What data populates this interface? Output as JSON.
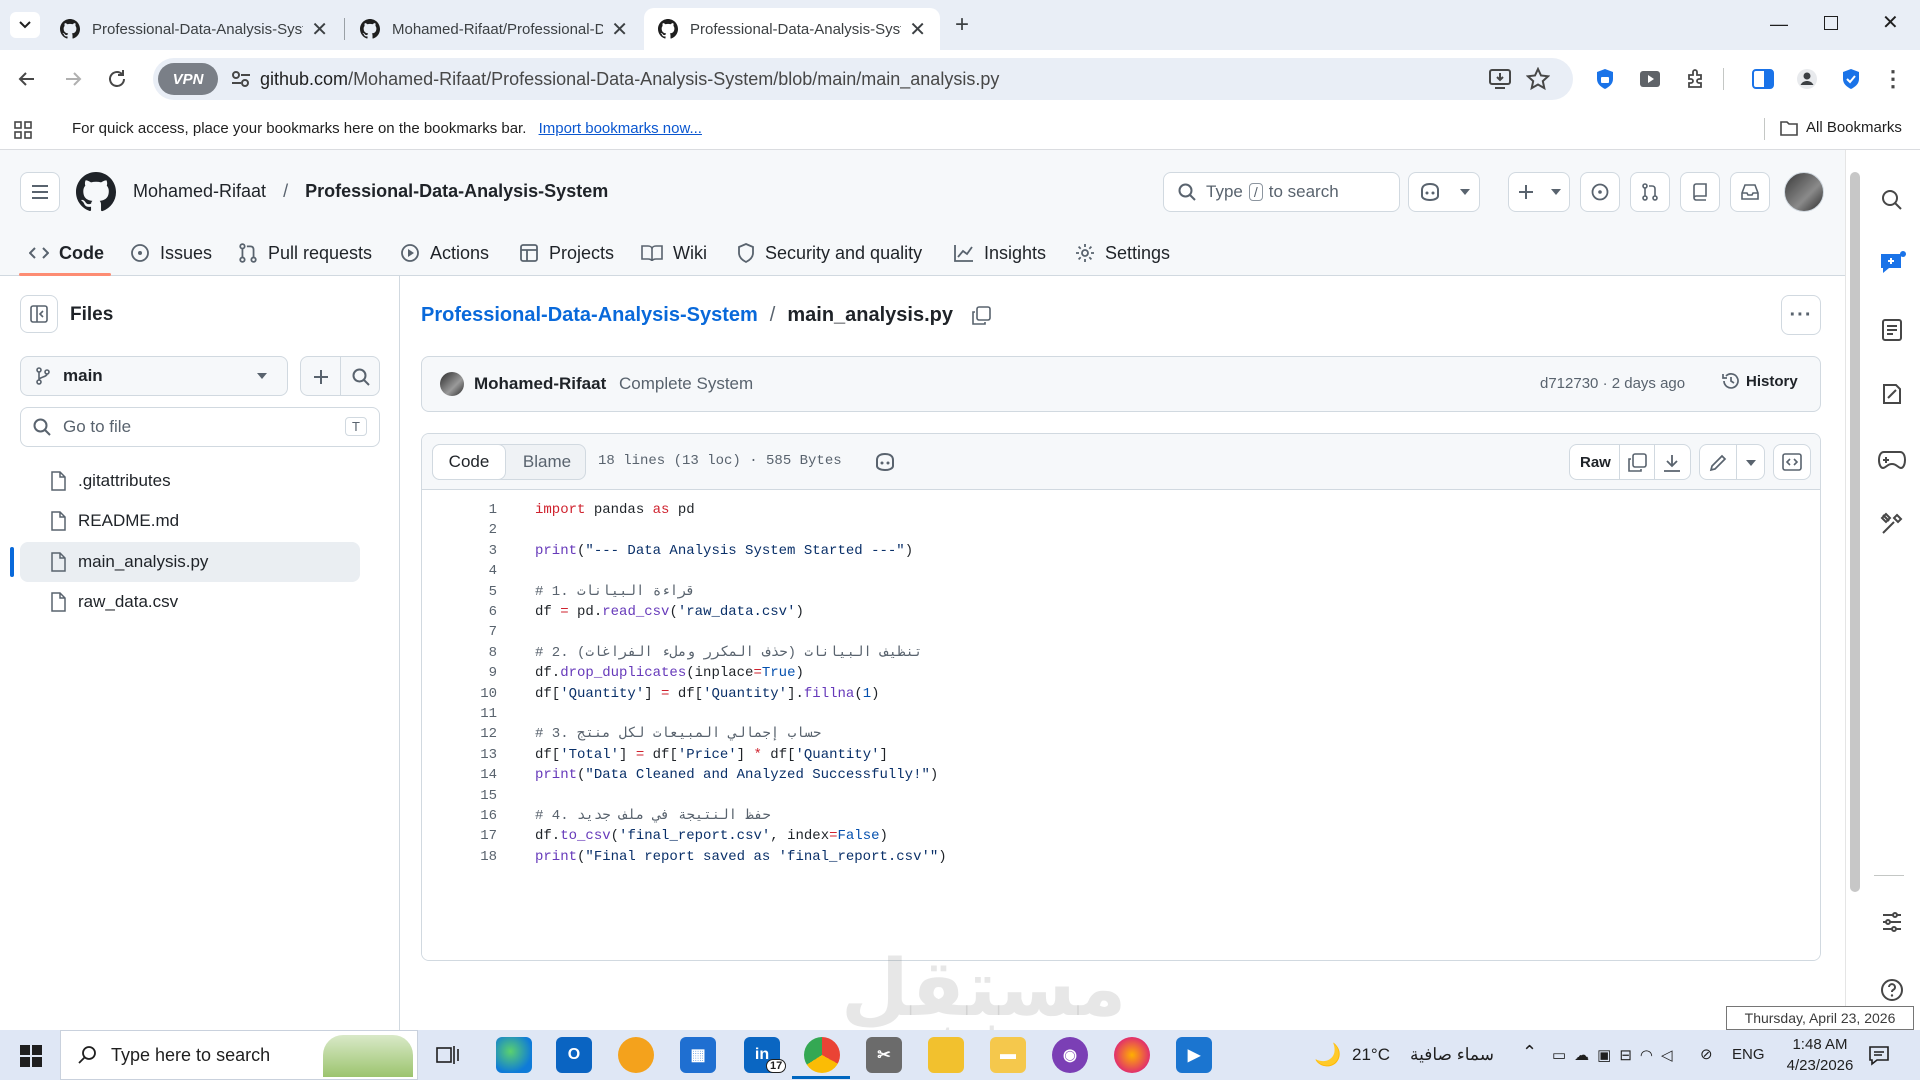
{
  "browser": {
    "tabs": [
      {
        "label": "Professional-Data-Analysis-Syst",
        "active": false
      },
      {
        "label": "Mohamed-Rifaat/Professional-D",
        "active": false
      },
      {
        "label": "Professional-Data-Analysis-Syst",
        "active": true
      }
    ],
    "url_host": "github.com",
    "url_path": "/Mohamed-Rifaat/Professional-Data-Analysis-System/blob/main/main_analysis.py",
    "vpn_label": "VPN",
    "bookmarks_text": "For quick access, place your bookmarks here on the bookmarks bar.",
    "bookmarks_link": "Import bookmarks now...",
    "all_bookmarks": "All Bookmarks"
  },
  "github": {
    "owner": "Mohamed-Rifaat",
    "separator": "/",
    "repo": "Professional-Data-Analysis-System",
    "search_prefix": "Type",
    "search_key": "/",
    "search_suffix": "to search",
    "nav": [
      {
        "label": "Code",
        "icon": "code-icon",
        "active": true
      },
      {
        "label": "Issues",
        "icon": "issue-icon"
      },
      {
        "label": "Pull requests",
        "icon": "pull-request-icon"
      },
      {
        "label": "Actions",
        "icon": "play-icon"
      },
      {
        "label": "Projects",
        "icon": "table-icon"
      },
      {
        "label": "Wiki",
        "icon": "book-icon"
      },
      {
        "label": "Security and quality",
        "icon": "shield-icon"
      },
      {
        "label": "Insights",
        "icon": "graph-icon"
      },
      {
        "label": "Settings",
        "icon": "gear-icon"
      }
    ],
    "files_panel": {
      "title": "Files",
      "branch": "main",
      "goto_placeholder": "Go to file",
      "goto_key": "T",
      "files": [
        {
          "name": ".gitattributes",
          "selected": false
        },
        {
          "name": "README.md",
          "selected": false
        },
        {
          "name": "main_analysis.py",
          "selected": true
        },
        {
          "name": "raw_data.csv",
          "selected": false
        }
      ]
    },
    "file": {
      "breadcrumb_repo": "Professional-Data-Analysis-System",
      "breadcrumb_sep": "/",
      "filename": "main_analysis.py",
      "commit_author": "Mohamed-Rifaat",
      "commit_message": "Complete System",
      "commit_meta": "d712730 · 2 days ago",
      "history_label": "History",
      "tab_code": "Code",
      "tab_blame": "Blame",
      "stats": "18 lines (13 loc) · 585 Bytes",
      "raw_label": "Raw"
    },
    "code_lines": [
      [
        {
          "t": "import",
          "c": "kw"
        },
        {
          "t": " pandas "
        },
        {
          "t": "as",
          "c": "kw"
        },
        {
          "t": " pd"
        }
      ],
      [],
      [
        {
          "t": "print",
          "c": "fn"
        },
        {
          "t": "("
        },
        {
          "t": "\"--- Data Analysis System Started ---\"",
          "c": "st"
        },
        {
          "t": ")"
        }
      ],
      [],
      [
        {
          "t": "# 1. قراءة البيانات",
          "c": "cm"
        }
      ],
      [
        {
          "t": "df "
        },
        {
          "t": "=",
          "c": "kw"
        },
        {
          "t": " pd."
        },
        {
          "t": "read_csv",
          "c": "fn"
        },
        {
          "t": "("
        },
        {
          "t": "'raw_data.csv'",
          "c": "st"
        },
        {
          "t": ")"
        }
      ],
      [],
      [
        {
          "t": "# 2. تنظيف البيانات (حذف المكرر وملء الفراغات)",
          "c": "cm"
        }
      ],
      [
        {
          "t": "df."
        },
        {
          "t": "drop_duplicates",
          "c": "fn"
        },
        {
          "t": "(inplace"
        },
        {
          "t": "=",
          "c": "kw"
        },
        {
          "t": "True",
          "c": "nm"
        },
        {
          "t": ")"
        }
      ],
      [
        {
          "t": "df["
        },
        {
          "t": "'Quantity'",
          "c": "st"
        },
        {
          "t": "] "
        },
        {
          "t": "=",
          "c": "kw"
        },
        {
          "t": " df["
        },
        {
          "t": "'Quantity'",
          "c": "st"
        },
        {
          "t": "]."
        },
        {
          "t": "fillna",
          "c": "fn"
        },
        {
          "t": "("
        },
        {
          "t": "1",
          "c": "nm"
        },
        {
          "t": ")"
        }
      ],
      [],
      [
        {
          "t": "# 3. حساب إجمالي المبيعات لكل منتج",
          "c": "cm"
        }
      ],
      [
        {
          "t": "df["
        },
        {
          "t": "'Total'",
          "c": "st"
        },
        {
          "t": "] "
        },
        {
          "t": "=",
          "c": "kw"
        },
        {
          "t": " df["
        },
        {
          "t": "'Price'",
          "c": "st"
        },
        {
          "t": "] "
        },
        {
          "t": "*",
          "c": "kw"
        },
        {
          "t": " df["
        },
        {
          "t": "'Quantity'",
          "c": "st"
        },
        {
          "t": "]"
        }
      ],
      [
        {
          "t": "print",
          "c": "fn"
        },
        {
          "t": "("
        },
        {
          "t": "\"Data Cleaned and Analyzed Successfully!\"",
          "c": "st"
        },
        {
          "t": ")"
        }
      ],
      [],
      [
        {
          "t": "# 4. حفظ النتيجة في ملف جديد",
          "c": "cm"
        }
      ],
      [
        {
          "t": "df."
        },
        {
          "t": "to_csv",
          "c": "fn"
        },
        {
          "t": "("
        },
        {
          "t": "'final_report.csv'",
          "c": "st"
        },
        {
          "t": ", index"
        },
        {
          "t": "=",
          "c": "kw"
        },
        {
          "t": "False",
          "c": "nm"
        },
        {
          "t": ")"
        }
      ],
      [
        {
          "t": "print",
          "c": "fn"
        },
        {
          "t": "("
        },
        {
          "t": "\"Final report saved as 'final_report.csv'\"",
          "c": "st"
        },
        {
          "t": ")"
        }
      ]
    ]
  },
  "watermark": {
    "arabic": "مستقل",
    "latin": "mostaql.com"
  },
  "taskbar": {
    "search_placeholder": "Type here to search",
    "linkedin_badge": "17",
    "weather_temp": "21°C",
    "weather_desc": "سماء صافية",
    "lang": "ENG",
    "time": "1:48 AM",
    "date": "4/23/2026",
    "tooltip": "Thursday, April 23, 2026"
  },
  "colors": {
    "accent_link": "#0969da",
    "tab_strip": "#e9eef6",
    "taskbar": "#dfe7f5",
    "nav_underline": "#fd8c73",
    "selected_bar": "#0969da"
  }
}
